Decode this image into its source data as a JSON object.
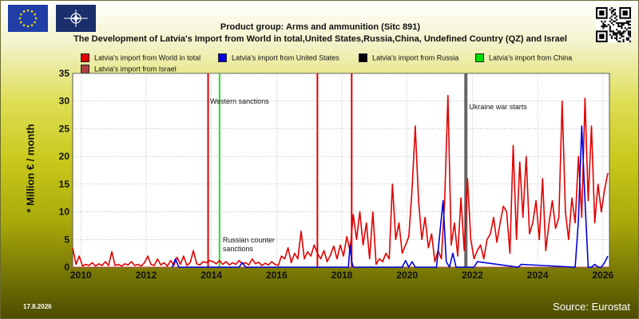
{
  "header": {
    "title_line1": "Product group: Arms and ammunition (Sitc 891)",
    "title_line2": "The Development of Latvia's Import from World in total,United States,Russia,China, Undefined Country (QZ) and Israel"
  },
  "logos": {
    "left_flag": "eu-flag-icon",
    "right_flag": "nato-flag-icon",
    "qr": "qr-code-icon"
  },
  "footer": {
    "date": "17.8.2026",
    "source": "Source: Eurostat"
  },
  "colors": {
    "world": "#e00000",
    "us": "#0000dd",
    "russia": "#000000",
    "china": "#00dd00",
    "israel": "#b04040"
  },
  "chart_data": {
    "type": "line",
    "title": "The Development of Latvia's Import from World in total,United States,Russia,China, Undefined Country (QZ) and Israel",
    "ylabel": "* Million € / month",
    "xlabel": "",
    "xlim": [
      2009.75,
      2026.2
    ],
    "ylim": [
      0,
      35
    ],
    "x_ticks": [
      2010,
      2012,
      2014,
      2016,
      2018,
      2020,
      2022,
      2024,
      2026
    ],
    "x_tick_labels": [
      "2010",
      "2012",
      "2014",
      "2016",
      "2018",
      "2020",
      "2022",
      "2024",
      "2026"
    ],
    "y_ticks": [
      0,
      5,
      10,
      15,
      20,
      25,
      30,
      35
    ],
    "y_tick_labels": [
      "0",
      "5",
      "10",
      "15",
      "20",
      "25",
      "30",
      "35"
    ],
    "grid": true,
    "legend": [
      {
        "name": "Latvia's import from World in total",
        "color": "#e00000"
      },
      {
        "name": "Latvia's import from United States",
        "color": "#0000dd"
      },
      {
        "name": "Latvia's import from Russia",
        "color": "#000000"
      },
      {
        "name": "Latvia's import from China",
        "color": "#00dd00"
      },
      {
        "name": "Latvia's import from Israel",
        "color": "#b04040"
      }
    ],
    "vertical_lines": [
      {
        "x": 2013.9,
        "color": "#e00000",
        "label": ""
      },
      {
        "x": 2014.25,
        "color": "#22dd22",
        "label": "Western sanctions",
        "label_y": 29.5
      },
      {
        "x": 2014.3,
        "color": "none",
        "label": "Russian counter sanctions",
        "label_y": 2.0
      },
      {
        "x": 2017.25,
        "color": "#e00000",
        "label": ""
      },
      {
        "x": 2018.3,
        "color": "#e00000",
        "label": ""
      },
      {
        "x": 2021.8,
        "color": "#666666",
        "label": "Ukraine war starts",
        "label_y": 28.5
      }
    ],
    "series": [
      {
        "name": "Latvia's import from World in total",
        "color": "#e00000",
        "x": [
          2009.75,
          2009.85,
          2009.95,
          2010.05,
          2010.15,
          2010.25,
          2010.35,
          2010.45,
          2010.55,
          2010.65,
          2010.75,
          2010.85,
          2010.95,
          2011.05,
          2011.15,
          2011.25,
          2011.35,
          2011.45,
          2011.55,
          2011.65,
          2011.75,
          2011.85,
          2011.95,
          2012.05,
          2012.15,
          2012.25,
          2012.35,
          2012.45,
          2012.55,
          2012.65,
          2012.75,
          2012.85,
          2012.95,
          2013.05,
          2013.15,
          2013.25,
          2013.35,
          2013.45,
          2013.55,
          2013.65,
          2013.75,
          2013.85,
          2013.95,
          2014.05,
          2014.15,
          2014.25,
          2014.35,
          2014.45,
          2014.55,
          2014.65,
          2014.75,
          2014.85,
          2014.95,
          2015.05,
          2015.15,
          2015.25,
          2015.35,
          2015.45,
          2015.55,
          2015.65,
          2015.75,
          2015.85,
          2015.95,
          2016.05,
          2016.15,
          2016.25,
          2016.35,
          2016.45,
          2016.55,
          2016.65,
          2016.75,
          2016.85,
          2016.95,
          2017.05,
          2017.15,
          2017.25,
          2017.35,
          2017.45,
          2017.55,
          2017.65,
          2017.75,
          2017.85,
          2017.95,
          2018.05,
          2018.15,
          2018.25,
          2018.35,
          2018.45,
          2018.55,
          2018.65,
          2018.75,
          2018.85,
          2018.95,
          2019.05,
          2019.15,
          2019.25,
          2019.35,
          2019.45,
          2019.55,
          2019.65,
          2019.75,
          2019.85,
          2019.95,
          2020.05,
          2020.15,
          2020.25,
          2020.35,
          2020.45,
          2020.55,
          2020.65,
          2020.75,
          2020.85,
          2020.95,
          2021.05,
          2021.15,
          2021.25,
          2021.35,
          2021.45,
          2021.55,
          2021.65,
          2021.75,
          2021.85,
          2021.95,
          2022.05,
          2022.15,
          2022.25,
          2022.35,
          2022.45,
          2022.55,
          2022.65,
          2022.75,
          2022.85,
          2022.95,
          2023.05,
          2023.15,
          2023.25,
          2023.35,
          2023.45,
          2023.55,
          2023.65,
          2023.75,
          2023.85,
          2023.95,
          2024.05,
          2024.15,
          2024.25,
          2024.35,
          2024.45,
          2024.55,
          2024.65,
          2024.75,
          2024.85,
          2024.95,
          2025.05,
          2025.15,
          2025.25,
          2025.35,
          2025.45,
          2025.55,
          2025.65,
          2025.75,
          2025.85,
          2025.95,
          2026.05,
          2026.15
        ],
        "values": [
          3.5,
          0.5,
          2.0,
          0.2,
          0.5,
          0.3,
          0.8,
          0.2,
          0.6,
          0.3,
          1.0,
          0.3,
          2.8,
          0.3,
          0.5,
          0.2,
          0.6,
          0.4,
          1.0,
          0.3,
          0.5,
          0.2,
          0.8,
          2.0,
          0.5,
          0.3,
          1.5,
          0.4,
          0.8,
          0.2,
          1.2,
          0.3,
          1.8,
          0.5,
          2.0,
          0.3,
          0.8,
          3.0,
          0.6,
          0.4,
          1.0,
          0.8,
          1.2,
          1.0,
          0.6,
          1.2,
          0.5,
          1.0,
          0.4,
          0.8,
          0.5,
          1.2,
          0.6,
          0.8,
          0.4,
          1.5,
          0.6,
          0.9,
          0.3,
          0.7,
          0.4,
          1.0,
          0.5,
          0.3,
          2.0,
          1.5,
          3.5,
          0.8,
          2.5,
          1.5,
          6.5,
          1.5,
          2.8,
          2.0,
          4.0,
          2.5,
          1.5,
          3.0,
          1.0,
          2.2,
          3.8,
          1.5,
          4.0,
          2.0,
          5.5,
          3.0,
          9.5,
          5.0,
          10.0,
          4.0,
          8.0,
          1.5,
          10.0,
          0.5,
          1.5,
          1.0,
          2.5,
          1.5,
          15.0,
          5.0,
          8.0,
          2.5,
          4.0,
          5.5,
          14.0,
          25.5,
          12.0,
          5.0,
          9.0,
          3.5,
          6.0,
          1.0,
          3.0,
          1.5,
          12.0,
          31.0,
          4.0,
          8.0,
          2.0,
          12.5,
          3.0,
          16.0,
          5.0,
          1.5,
          3.0,
          4.0,
          1.5,
          5.0,
          6.0,
          9.0,
          4.5,
          8.0,
          11.0,
          10.0,
          2.5,
          22.0,
          5.0,
          19.0,
          9.0,
          20.0,
          6.0,
          8.0,
          12.0,
          5.0,
          16.0,
          3.0,
          8.0,
          12.0,
          7.0,
          9.0,
          30.0,
          10.0,
          5.0,
          12.5,
          8.0,
          20.0,
          9.0,
          30.5,
          12.0,
          25.5,
          8.0,
          15.0,
          10.0,
          14.0,
          17.0
        ]
      },
      {
        "name": "Latvia's import from United States",
        "color": "#0000dd",
        "x": [
          2012.8,
          2012.9,
          2013.0,
          2013.1,
          2014.85,
          2014.95,
          2015.05,
          2015.15,
          2018.2,
          2018.25,
          2018.3,
          2018.35,
          2019.85,
          2019.95,
          2020.05,
          2020.15,
          2020.25,
          2020.35,
          2020.9,
          2021.0,
          2021.1,
          2021.2,
          2021.3,
          2021.4,
          2021.5,
          2021.6,
          2022.05,
          2022.15,
          2023.4,
          2023.5,
          2025.15,
          2025.25,
          2025.35,
          2025.45,
          2025.55,
          2025.65,
          2025.75,
          2025.85,
          2025.95,
          2026.05,
          2026.15
        ],
        "values": [
          0,
          1.5,
          0,
          0,
          0,
          0.8,
          0,
          0,
          0,
          4.0,
          1.0,
          0,
          0,
          1.2,
          0,
          1.0,
          0,
          0,
          0,
          6.0,
          12.0,
          1.0,
          0,
          2.5,
          0,
          0,
          0,
          1.0,
          0,
          0.5,
          0,
          8.5,
          25.5,
          12.0,
          0,
          0,
          0.5,
          0,
          0,
          0.8,
          2.0
        ]
      },
      {
        "name": "Latvia's import from Russia",
        "color": "#000000",
        "x": [
          2009.75,
          2026.2
        ],
        "values": [
          0,
          0
        ]
      },
      {
        "name": "Latvia's import from China",
        "color": "#00dd00",
        "x": [
          2009.75,
          2026.2
        ],
        "values": [
          0,
          0
        ]
      },
      {
        "name": "Latvia's import from Israel",
        "color": "#b04040",
        "x": [
          2009.75,
          2026.2
        ],
        "values": [
          0,
          0
        ]
      }
    ]
  }
}
